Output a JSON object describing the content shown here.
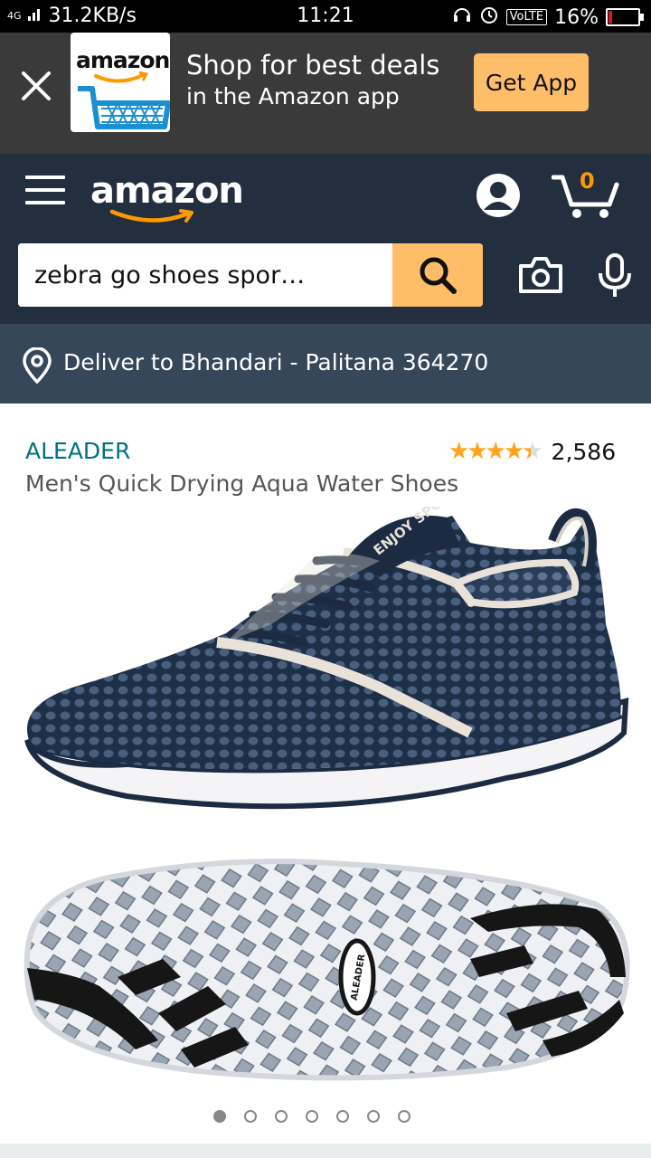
{
  "status_bar": {
    "network": "4G",
    "speed": "31.2KB/s",
    "time": "11:21",
    "volte": "VoLTE",
    "battery": "16%",
    "battery_level": 0.16,
    "battery_color": "#e31313"
  },
  "app_banner": {
    "logo_text": "amazon",
    "line1": "Shop for best deals",
    "line2": "in the Amazon app",
    "button_label": "Get App",
    "button_color": "#febd69"
  },
  "header": {
    "logo_text": "amazon",
    "cart_count": "0",
    "background": "#232f3e",
    "accent": "#ff9900"
  },
  "search": {
    "value": "zebra go shoes spor…"
  },
  "delivery": {
    "text": "Deliver to Bhandari - Palitana 364270"
  },
  "product": {
    "brand": "ALEADER",
    "title": "Men's Quick Drying Aqua Water Shoes",
    "rating": 4.5,
    "stars": "★★★★★",
    "review_count": "2,586",
    "shoe_tongue_text": "ENJOY SPORTS",
    "sole_logo_text": "ALEADER"
  },
  "carousel": {
    "total": 7,
    "active": 0
  }
}
